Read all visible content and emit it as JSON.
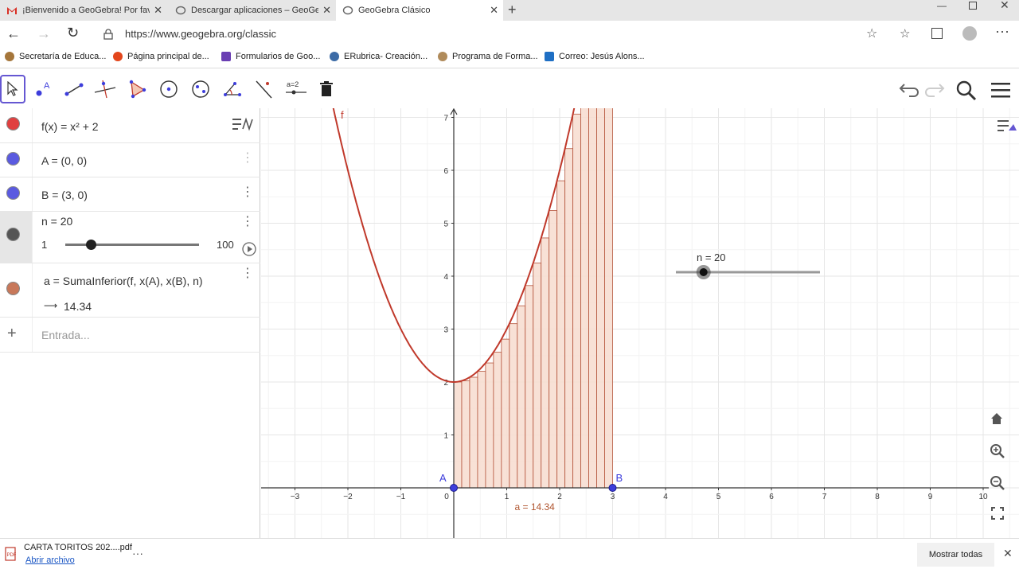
{
  "browser": {
    "tabs": [
      {
        "label": "¡Bienvenido a GeoGebra! Por fav",
        "icon": "gmail-icon"
      },
      {
        "label": "Descargar aplicaciones – GeoGe",
        "icon": "geogebra-icon"
      },
      {
        "label": "GeoGebra Clásico",
        "icon": "geogebra-icon"
      }
    ],
    "url": "https://www.geogebra.org/classic",
    "bookmarks": [
      {
        "label": "Secretaría de Educa...",
        "color": "#a5763b"
      },
      {
        "label": "Página principal de...",
        "color": "#e3461c"
      },
      {
        "label": "Formularios de Goo...",
        "color": "#6a3fb3"
      },
      {
        "label": "ERubrica- Creación...",
        "color": "#3c6ba6"
      },
      {
        "label": "Programa de Forma...",
        "color": "#b08b5b"
      },
      {
        "label": "Correo: Jesús Alons...",
        "color": "#1f6fc4"
      }
    ]
  },
  "algebra": {
    "items": [
      {
        "expr": "f(x)  =  x² + 2",
        "color": "#e04040"
      },
      {
        "expr": "A  =  (0, 0)",
        "color": "#5a5ae0"
      },
      {
        "expr": "B  =  (3, 0)",
        "color": "#5a5ae0"
      },
      {
        "expr": "n = 20",
        "color": "#555555"
      },
      {
        "expr": "a  =  SumaInferior(f, x(A), x(B), n)",
        "color": "#c8785a"
      }
    ],
    "slider_min": "1",
    "slider_max": "100",
    "slider_value": 20,
    "result_arrow": "⟶",
    "result_value": "14.34",
    "input_placeholder": "Entrada...",
    "add_symbol": "+"
  },
  "graphics": {
    "x_ticks": [
      "−3",
      "−2",
      "−1",
      "0",
      "1",
      "2",
      "3",
      "4",
      "5",
      "6",
      "7",
      "8",
      "9",
      "10"
    ],
    "y_ticks": [
      "1",
      "2",
      "3",
      "4",
      "5",
      "6",
      "7"
    ],
    "function_label": "f",
    "point_a_label": "A",
    "point_b_label": "B",
    "slider_caption": "n = 20",
    "area_caption": "a = 14.34",
    "colors": {
      "curve": "#c0392b",
      "rect_fill": "#f7dccf",
      "rect_stroke": "#b5553c",
      "point": "#3d3ddb",
      "grid": "#e6e6e6",
      "caption": "#b0552f"
    }
  },
  "download": {
    "filename": "CARTA TORITOS 202....pdf",
    "open_link": "Abrir archivo",
    "show_all": "Mostrar todas",
    "more": "···"
  }
}
